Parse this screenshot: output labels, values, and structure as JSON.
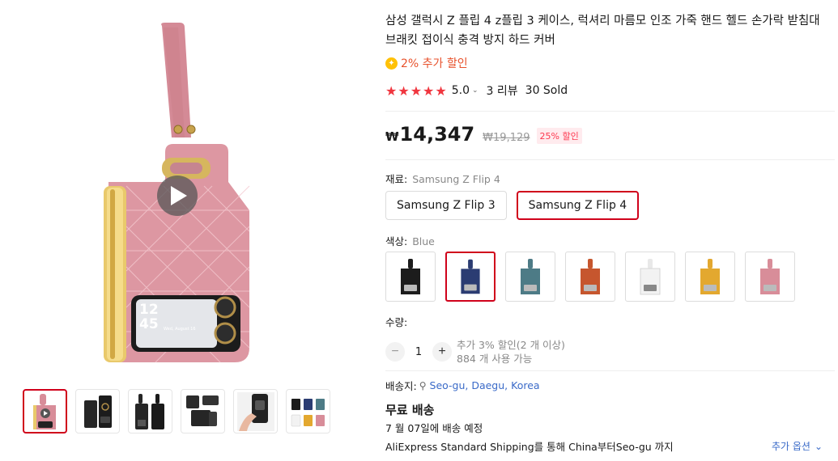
{
  "gallery": {
    "play_icon": "play-icon",
    "main_phone": {
      "body_color": "#d88d99",
      "clock_time_h": "12",
      "clock_time_m": "45",
      "clock_date": "Wed, August 16"
    },
    "thumbnails": [
      {
        "name": "thumb-pink-video",
        "color": "#d88d99"
      },
      {
        "name": "thumb-black-ring",
        "color": "#222222"
      },
      {
        "name": "thumb-black-pair",
        "color": "#222222"
      },
      {
        "name": "thumb-black-kickstand",
        "color": "#333333"
      },
      {
        "name": "thumb-hand-hold",
        "color": "#2a2a2a"
      },
      {
        "name": "thumb-color-grid",
        "color": "#ffffff"
      }
    ]
  },
  "product": {
    "title": "삼성 갤럭시 Z 플립 4 z플립 3 케이스, 럭셔리 마름모 인조 가죽 핸드 헬드 손가락 받침대 브래킷 접이식 충격 방지 하드 커버",
    "promo_text": "2% 추가 할인",
    "promo_icon": "coin-icon",
    "rating_value": "5.0",
    "reviews": "3 리뷰",
    "sold": "30 Sold",
    "stars_filled": 5
  },
  "price": {
    "currency": "₩",
    "current": "14,347",
    "original": "₩19,129",
    "discount_badge": "25% 할인"
  },
  "material": {
    "label": "재료:",
    "selected": "Samsung Z Flip 4",
    "options": [
      "Samsung Z Flip 3",
      "Samsung Z Flip 4"
    ],
    "active_index": 1
  },
  "color": {
    "label": "색상:",
    "selected": "Blue",
    "swatches": [
      {
        "name": "black",
        "hex": "#1c1c1c"
      },
      {
        "name": "blue",
        "hex": "#2b3c72"
      },
      {
        "name": "teal",
        "hex": "#4d7b86"
      },
      {
        "name": "orange",
        "hex": "#c6562e"
      },
      {
        "name": "white",
        "hex": "#f2f2f2"
      },
      {
        "name": "yellow",
        "hex": "#e3a82f"
      },
      {
        "name": "pink",
        "hex": "#d88d99"
      }
    ],
    "active_index": 1
  },
  "quantity": {
    "label": "수량:",
    "value": "1",
    "minus": "−",
    "plus": "+",
    "note_line1": "추가 3% 할인(2 개 이상)",
    "note_line2": "884 개 사용 가능"
  },
  "shipping": {
    "label": "배송지:",
    "location": "Seo-gu, Daegu, Korea",
    "free_label": "무료 배송",
    "eta": "7 월 07일에 배송 예정",
    "standard": "AliExpress Standard Shipping를 통해 China부터Seo-gu 까지",
    "more_options": "추가 옵션"
  },
  "colors": {
    "accent_red": "#d0021b",
    "star_red": "#f0363f",
    "link_blue": "#3a6ac8",
    "promo_orange": "#e8522c"
  }
}
